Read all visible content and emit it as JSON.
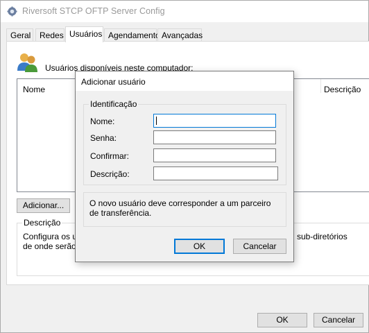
{
  "window": {
    "title": "Riversoft  STCP OFTP Server Config",
    "app_icon": "gear-icon"
  },
  "tabs": [
    {
      "label": "Geral",
      "active": false
    },
    {
      "label": "Redes",
      "active": false
    },
    {
      "label": "Usuários",
      "active": true
    },
    {
      "label": "Agendamento",
      "active": false
    },
    {
      "label": "Avançadas",
      "active": false
    }
  ],
  "users_panel": {
    "icon": "users-icon",
    "available_label": "Usuários disponíveis neste computador:",
    "columns": [
      "Nome",
      "Descrição"
    ],
    "add_button": "Adicionar...",
    "description_group": {
      "label": "Descrição",
      "text_line1": "Configura os usu",
      "text_line2": "de onde serão e",
      "text_right": "sub-diretórios"
    }
  },
  "footer": {
    "ok_label": "OK",
    "cancel_label": "Cancelar"
  },
  "dialog": {
    "title": "Adicionar usuário",
    "identification_group": "Identificação",
    "fields": {
      "nome": {
        "label": "Nome:",
        "value": ""
      },
      "senha": {
        "label": "Senha:",
        "value": ""
      },
      "confirmar": {
        "label": "Confirmar:",
        "value": ""
      },
      "descricao": {
        "label": "Descrição:",
        "value": ""
      }
    },
    "info_text": "O novo usuário deve corresponder a um parceiro de transferência.",
    "ok_label": "OK",
    "cancel_label": "Cancelar"
  },
  "colors": {
    "accent": "#0078d7",
    "window_bg": "#f0f0f0",
    "button_bg": "#e1e1e1"
  }
}
